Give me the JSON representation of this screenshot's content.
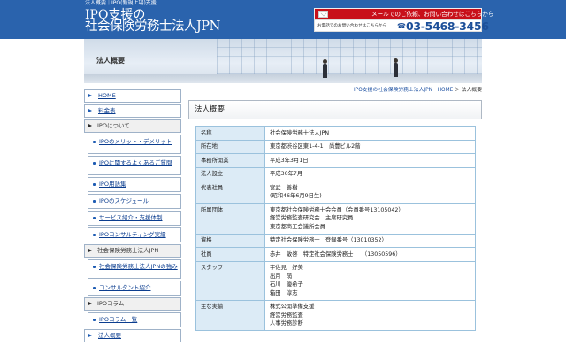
{
  "header": {
    "tagline": "法人概要｜IPO(新規上場)支援",
    "sub_title": "IPO支援の",
    "title": "社会保険労務士法人JPN",
    "contact_banner": "メールでのご依頼、お問い合わせはこちらから",
    "phone_label": "お電話でのお問い合わせはこちらから",
    "phone_number": "03-5468-3456",
    "brand_color": "#2a63ad",
    "accent_color": "#c8101a"
  },
  "hero": {
    "title": "法人概要"
  },
  "breadcrumb": {
    "home_link": "IPO支援の社会保険労務士法人JPN　HOME",
    "separator": "＞",
    "current": "法人概要"
  },
  "sidebar": {
    "home": "HOME",
    "pricing": "料金表",
    "about_ipo": "IPOについて",
    "merits": "IPOのメリット・デメリット",
    "faq": "IPOに関するよくあるご質問",
    "glossary": "IPO用語集",
    "schedule": "IPOのスケジュール",
    "services": "サービス紹介・支援体制",
    "consulting": "IPOコンサルティング実績",
    "firm": "社会保険労務士法人JPN",
    "strengths": "社会保険労務士法人JPNの強み",
    "consultants": "コンサルタント紹介",
    "column": "IPOコラム",
    "column_list": "IPOコラム一覧",
    "overview": "法人概要"
  },
  "main": {
    "title": "法人概要",
    "rows": [
      {
        "label": "名称",
        "lines": [
          "社会保険労務士法人JPN"
        ]
      },
      {
        "label": "所在地",
        "lines": [
          "東京都渋谷区東1-4-1　尚豊ビル2階"
        ]
      },
      {
        "label": "事務所開業",
        "lines": [
          "平成3年3月1日"
        ]
      },
      {
        "label": "法人設立",
        "lines": [
          "平成30年7月"
        ]
      },
      {
        "label": "代表社員",
        "lines": [
          "宮武　善樹",
          "(昭和46年6月9日生)"
        ]
      },
      {
        "label": "所属団体",
        "lines": [
          "東京都社会保険労務士会会員（会員番号13105042）",
          "経営労務監査研究会　主席研究員",
          "東京都商工会議所会員"
        ]
      },
      {
        "label": "資格",
        "lines": [
          "特定社会保険労務士　登録番号（13010352）"
        ]
      },
      {
        "label": "社員",
        "lines": [
          "赤井　敏啓　特定社会保険労務士　　（13050596）"
        ]
      },
      {
        "label": "スタッフ",
        "lines": [
          "宇佐見　好美",
          "出月　萌",
          "石川　優希子",
          "箱田　淳志"
        ]
      },
      {
        "label": "主な実績",
        "lines": [
          "株式公開準備支援",
          "経営労務監査",
          "人事労務診断"
        ]
      }
    ]
  }
}
